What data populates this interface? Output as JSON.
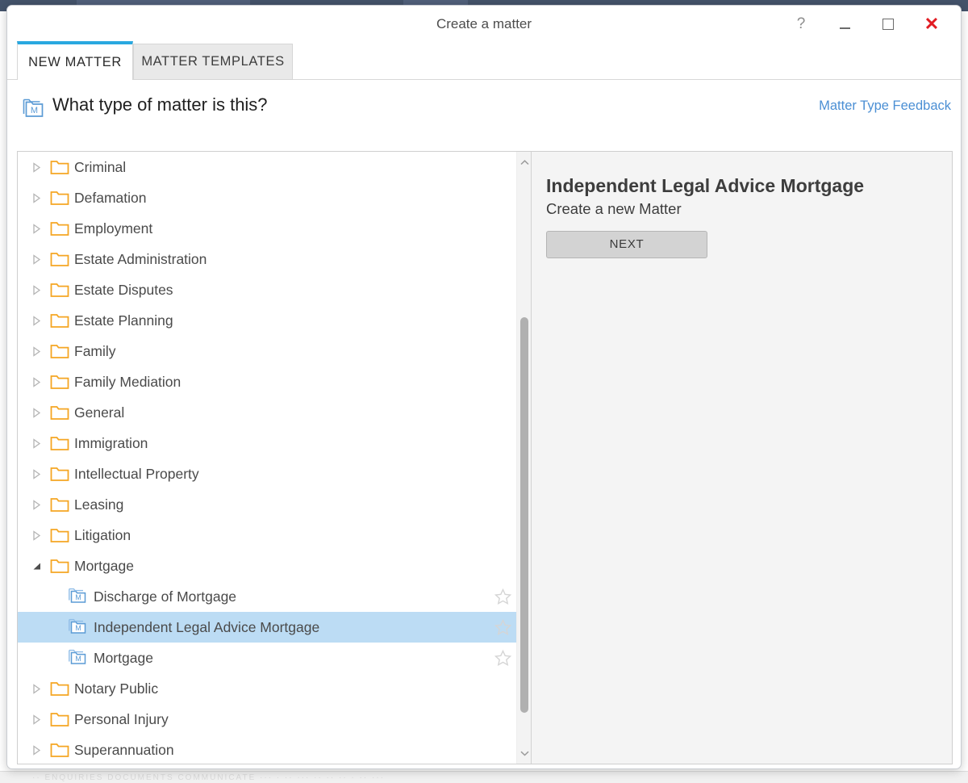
{
  "window": {
    "title": "Create a matter",
    "controls": {
      "help": "?",
      "minimize": "minimize-icon",
      "maximize": "maximize-icon",
      "close": "✕"
    }
  },
  "tabs": [
    {
      "label": "NEW MATTER",
      "active": true
    },
    {
      "label": "MATTER TEMPLATES",
      "active": false
    }
  ],
  "header": {
    "icon": "matter-folder-icon",
    "question": "What type of matter is this?",
    "feedback_link": "Matter Type Feedback"
  },
  "tree": {
    "items": [
      {
        "label": "Criminal",
        "type": "folder",
        "expanded": false,
        "selected": false
      },
      {
        "label": "Defamation",
        "type": "folder",
        "expanded": false,
        "selected": false
      },
      {
        "label": "Employment",
        "type": "folder",
        "expanded": false,
        "selected": false
      },
      {
        "label": "Estate Administration",
        "type": "folder",
        "expanded": false,
        "selected": false
      },
      {
        "label": "Estate Disputes",
        "type": "folder",
        "expanded": false,
        "selected": false
      },
      {
        "label": "Estate Planning",
        "type": "folder",
        "expanded": false,
        "selected": false
      },
      {
        "label": "Family",
        "type": "folder",
        "expanded": false,
        "selected": false
      },
      {
        "label": "Family Mediation",
        "type": "folder",
        "expanded": false,
        "selected": false
      },
      {
        "label": "General",
        "type": "folder",
        "expanded": false,
        "selected": false
      },
      {
        "label": "Immigration",
        "type": "folder",
        "expanded": false,
        "selected": false
      },
      {
        "label": "Intellectual Property",
        "type": "folder",
        "expanded": false,
        "selected": false
      },
      {
        "label": "Leasing",
        "type": "folder",
        "expanded": false,
        "selected": false
      },
      {
        "label": "Litigation",
        "type": "folder",
        "expanded": false,
        "selected": false
      },
      {
        "label": "Mortgage",
        "type": "folder",
        "expanded": true,
        "selected": false
      },
      {
        "label": "Discharge of Mortgage",
        "type": "matter",
        "child": true,
        "selected": false,
        "favourite": false
      },
      {
        "label": "Independent Legal Advice Mortgage",
        "type": "matter",
        "child": true,
        "selected": true,
        "favourite": false
      },
      {
        "label": "Mortgage",
        "type": "matter",
        "child": true,
        "selected": false,
        "favourite": false
      },
      {
        "label": "Notary Public",
        "type": "folder",
        "expanded": false,
        "selected": false
      },
      {
        "label": "Personal Injury",
        "type": "folder",
        "expanded": false,
        "selected": false
      },
      {
        "label": "Superannuation",
        "type": "folder",
        "expanded": false,
        "selected": false
      }
    ],
    "scrollbar": {
      "up_arrow": "chevron-up-icon",
      "down_arrow": "chevron-down-icon"
    }
  },
  "detail": {
    "title": "Independent Legal Advice Mortgage",
    "subtitle": "Create a new Matter",
    "next_label": "NEXT"
  },
  "colors": {
    "accent_tab": "#29a8e0",
    "folder": "#f5a623",
    "matter_icon": "#5b9bd5",
    "selection": "#bcdcf4",
    "link": "#4b8fd4",
    "close": "#e11b22"
  },
  "desktop": {
    "bottom_strip_text": "··   ENQUIRIES     DOCUMENTS     COMMUNICATE              ···   ·            ··  ···  ··   ··  ··  · ··  ···"
  }
}
